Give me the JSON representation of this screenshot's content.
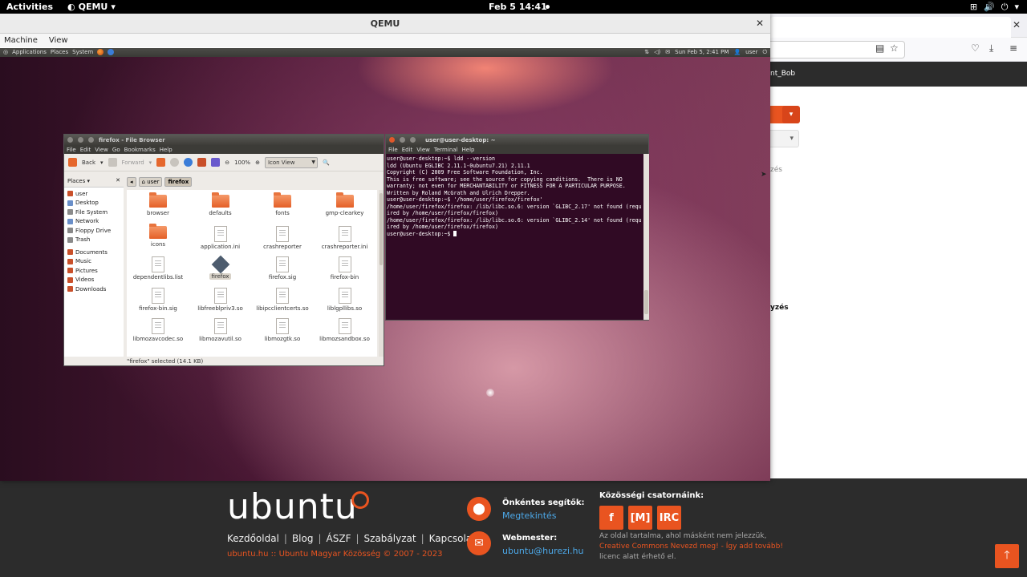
{
  "topbar": {
    "activities": "Activities",
    "app_name": "QEMU",
    "clock": "Feb 5  14:41"
  },
  "qemu": {
    "title": "QEMU",
    "menu": [
      "Machine",
      "View"
    ]
  },
  "guest_panel": {
    "menus": [
      "Applications",
      "Places",
      "System"
    ],
    "clock": "Sun Feb  5,  2:41 PM",
    "user": "user"
  },
  "file_browser": {
    "title": "firefox - File Browser",
    "menu": [
      "File",
      "Edit",
      "View",
      "Go",
      "Bookmarks",
      "Help"
    ],
    "back_label": "Back",
    "forward_label": "Forward",
    "zoom": "100%",
    "view_mode": "Icon View",
    "places_label": "Places",
    "places": [
      "user",
      "Desktop",
      "File System",
      "Network",
      "Floppy Drive",
      "Trash",
      "Documents",
      "Music",
      "Pictures",
      "Videos",
      "Downloads"
    ],
    "path": [
      "user",
      "firefox"
    ],
    "items": [
      {
        "name": "browser",
        "type": "folder"
      },
      {
        "name": "defaults",
        "type": "folder"
      },
      {
        "name": "fonts",
        "type": "folder"
      },
      {
        "name": "gmp-clearkey",
        "type": "folder"
      },
      {
        "name": "icons",
        "type": "folder"
      },
      {
        "name": "application.ini",
        "type": "doc"
      },
      {
        "name": "crashreporter",
        "type": "doc"
      },
      {
        "name": "crashreporter.ini",
        "type": "doc"
      },
      {
        "name": "dependentlibs.list",
        "type": "doc"
      },
      {
        "name": "firefox",
        "type": "exec"
      },
      {
        "name": "firefox.sig",
        "type": "doc"
      },
      {
        "name": "firefox-bin",
        "type": "doc"
      },
      {
        "name": "firefox-bin.sig",
        "type": "doc"
      },
      {
        "name": "libfreeblpriv3.so",
        "type": "doc"
      },
      {
        "name": "libipcclientcerts.so",
        "type": "doc"
      },
      {
        "name": "liblgpllibs.so",
        "type": "doc"
      },
      {
        "name": "libmozavcodec.so",
        "type": "doc"
      },
      {
        "name": "libmozavutil.so",
        "type": "doc"
      },
      {
        "name": "libmozgtk.so",
        "type": "doc"
      },
      {
        "name": "libmozsandbox.so",
        "type": "doc"
      }
    ],
    "status": "\"firefox\" selected (14.1 KB)"
  },
  "terminal": {
    "title": "user@user-desktop: ~",
    "menu": [
      "File",
      "Edit",
      "View",
      "Terminal",
      "Help"
    ],
    "lines": [
      "user@user-desktop:~$ ldd --version",
      "ldd (Ubuntu EGLIBC 2.11.1-0ubuntu7.21) 2.11.1",
      "Copyright (C) 2009 Free Software Foundation, Inc.",
      "This is free software; see the source for copying conditions.  There is NO",
      "warranty; not even for MERCHANTABILITY or FITNESS FOR A PARTICULAR PURPOSE.",
      "Written by Roland McGrath and Ulrich Drepper.",
      "user@user-desktop:~$ '/home/user/firefox/firefox'",
      "/home/user/firefox/firefox: /lib/libc.so.6: version `GLIBC_2.17' not found (requ",
      "ired by /home/user/firefox/firefox)",
      "/home/user/firefox/firefox: /lib/libc.so.6: version `GLIBC_2.14' not found (requ",
      "ired by /home/user/firefox/firefox)"
    ],
    "prompt": "user@user-desktop:~$ "
  },
  "firefox_bg": {
    "user_fragment": "nt_Bob",
    "text1": "zés",
    "text2": "yzés"
  },
  "footer": {
    "logo": "ubuntu",
    "links": [
      "Kezdőoldal",
      "Blog",
      "ÁSZF",
      "Szabályzat",
      "Kapcsolat"
    ],
    "copyright": "ubuntu.hu :: Ubuntu Magyar Közösség © 2007 - 2023",
    "volunteers_title": "Önkéntes segítők:",
    "volunteers_link": "Megtekintés",
    "webmaster_title": "Webmester:",
    "webmaster_email": "ubuntu@hurezi.hu",
    "channels_title": "Közösségi csatornáink:",
    "channels": [
      "f",
      "[M]",
      "IRC"
    ],
    "note_before": "Az oldal tartalma, ahol másként nem jelezzük,",
    "note_cc": "Creative Commons Nevezd meg! - Így add tovább!",
    "note_after": "licenc alatt érhető el."
  },
  "colors": {
    "ubuntu_orange": "#e95420",
    "terminal_bg": "#300a24",
    "footer_bg": "#2c2c2c"
  }
}
